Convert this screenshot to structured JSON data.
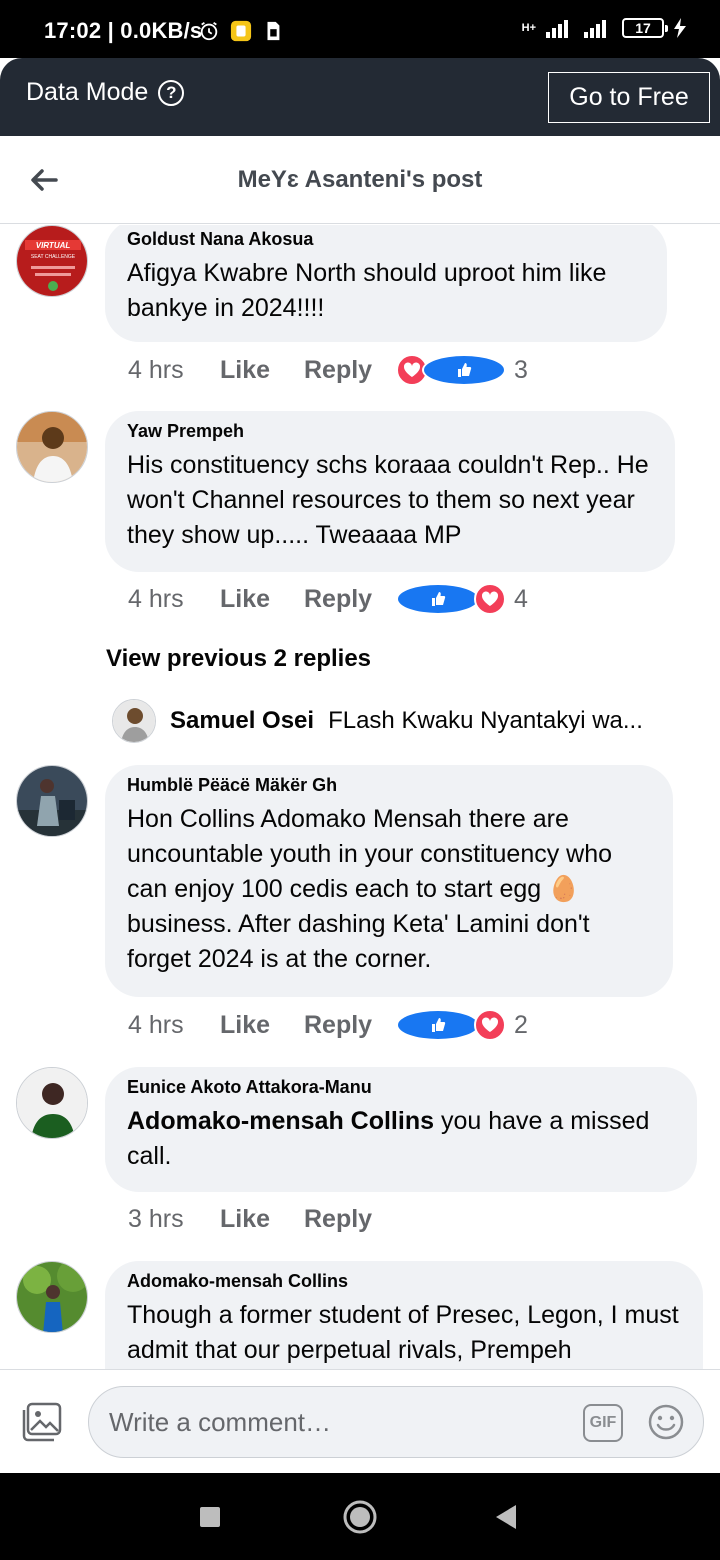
{
  "status_bar": {
    "time": "17:02",
    "speed": "0.0KB/s",
    "battery": "17",
    "network": "H+"
  },
  "data_mode": {
    "label": "Data Mode",
    "go_free": "Go to Free"
  },
  "header": {
    "title": "MeYɛ Asanteni's post"
  },
  "comments": [
    {
      "name": "Goldust Nana Akosua",
      "text": "Afigya Kwabre North should uproot him like bankye in 2024!!!!",
      "time": "4 hrs",
      "like": "Like",
      "reply": "Reply",
      "reactions": [
        "love",
        "like"
      ],
      "count": "3",
      "avatar_label": "VIRTUAL SEAT CHALLENGE"
    },
    {
      "name": "Yaw Prempeh",
      "text": "His constituency schs koraaa couldn't Rep.. He won't Channel resources to them so next year they show up..... Tweaaaa MP",
      "time": "4 hrs",
      "like": "Like",
      "reply": "Reply",
      "reactions": [
        "like",
        "love"
      ],
      "count": "4"
    },
    {
      "name": "Humblë Pëäcë Mäkër Gh",
      "text": "Hon Collins Adomako Mensah  there are uncountable youth in your constituency who can enjoy 100 cedis each to start egg 🥚 business. After dashing Keta' Lamini don't forget 2024 is at the corner.",
      "time": "4 hrs",
      "like": "Like",
      "reply": "Reply",
      "reactions": [
        "like",
        "love"
      ],
      "count": "2"
    },
    {
      "name": "Eunice Akoto Attakora-Manu",
      "mention": "Adomako-mensah Collins",
      "text": " you have a missed call.",
      "time": "3 hrs",
      "like": "Like",
      "reply": "Reply"
    },
    {
      "name": "Adomako-mensah Collins",
      "text": "Though a former student of Presec, Legon, I must admit that our perpetual rivals, Prempeh"
    }
  ],
  "view_previous": "View previous 2 replies",
  "reply_preview": {
    "name": "Samuel Osei",
    "text": "FLash Kwaku Nyantakyi wa..."
  },
  "composer": {
    "placeholder": "Write a comment…",
    "gif": "GIF"
  }
}
